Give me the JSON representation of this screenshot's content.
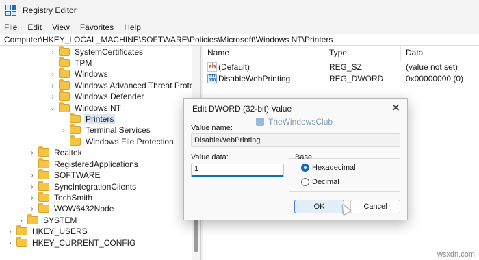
{
  "window": {
    "title": "Registry Editor"
  },
  "menu": [
    "File",
    "Edit",
    "View",
    "Favorites",
    "Help"
  ],
  "address": "Computer\\HKEY_LOCAL_MACHINE\\SOFTWARE\\Policies\\Microsoft\\Windows NT\\Printers",
  "tree": [
    {
      "label": "SystemCertificates",
      "chev": "›"
    },
    {
      "label": "TPM",
      "chev": ""
    },
    {
      "label": "Windows",
      "chev": "›"
    },
    {
      "label": "Windows Advanced Threat Protectio",
      "chev": "›"
    },
    {
      "label": "Windows Defender",
      "chev": "›"
    },
    {
      "label": "Windows NT",
      "chev": "⌄"
    },
    {
      "label": "Printers",
      "chev": ""
    },
    {
      "label": "Terminal Services",
      "chev": "›"
    },
    {
      "label": "Windows File Protection",
      "chev": ""
    },
    {
      "label": "Realtek",
      "chev": "›"
    },
    {
      "label": "RegisteredApplications",
      "chev": ""
    },
    {
      "label": "SOFTWARE",
      "chev": "›"
    },
    {
      "label": "SyncIntegrationClients",
      "chev": "›"
    },
    {
      "label": "TechSmith",
      "chev": "›"
    },
    {
      "label": "WOW6432Node",
      "chev": "›"
    },
    {
      "label": "SYSTEM",
      "chev": "›"
    },
    {
      "label": "HKEY_USERS",
      "chev": "›"
    },
    {
      "label": "HKEY_CURRENT_CONFIG",
      "chev": "›"
    }
  ],
  "list": {
    "columns": [
      "Name",
      "Type",
      "Data"
    ],
    "rows": [
      {
        "icon": "string-value-icon",
        "name": "(Default)",
        "type": "REG_SZ",
        "data": "(value not set)"
      },
      {
        "icon": "binary-value-icon",
        "name": "DisableWebPrinting",
        "type": "REG_DWORD",
        "data": "0x00000000 (0)"
      }
    ]
  },
  "dialog": {
    "title": "Edit DWORD (32-bit) Value",
    "close": "✕",
    "value_name_label": "Value name:",
    "value_name": "DisableWebPrinting",
    "value_data_label": "Value data:",
    "value_data": "1",
    "base_label": "Base",
    "radio_hex": "Hexadecimal",
    "radio_dec": "Decimal",
    "ok": "OK",
    "cancel": "Cancel"
  },
  "watermark": "TheWindowsClub",
  "site_mark": "wsxdn.com"
}
